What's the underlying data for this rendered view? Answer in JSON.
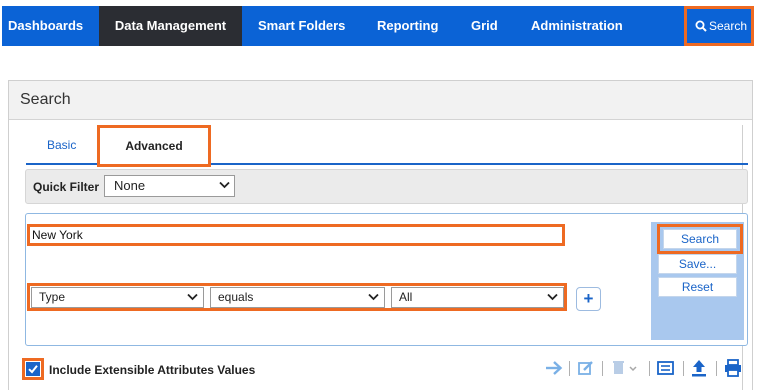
{
  "nav": {
    "items": [
      "Dashboards",
      "Data Management",
      "Smart Folders",
      "Reporting",
      "Grid",
      "Administration"
    ],
    "active": "Data Management",
    "search_label": "Search"
  },
  "panel": {
    "title": "Search"
  },
  "tabs": {
    "basic": "Basic",
    "advanced": "Advanced"
  },
  "quick_filter": {
    "label": "Quick Filter",
    "value": "None"
  },
  "query": {
    "value": "New York"
  },
  "condition": {
    "field": "Type",
    "operator": "equals",
    "value": "All",
    "add_label": "+"
  },
  "actions": {
    "search": "Search",
    "save": "Save...",
    "reset": "Reset"
  },
  "footer": {
    "include_label": "Include Extensible Attributes Values",
    "include_checked": true
  },
  "icons": [
    "arrow-right-icon",
    "edit-icon",
    "trash-icon",
    "list-icon",
    "upload-icon",
    "print-icon"
  ],
  "colors": {
    "nav": "#0b63d6",
    "nav_active": "#2b2d33",
    "highlight": "#ee6a22",
    "link": "#1a64c8",
    "button_column": "#a9c8ee"
  }
}
